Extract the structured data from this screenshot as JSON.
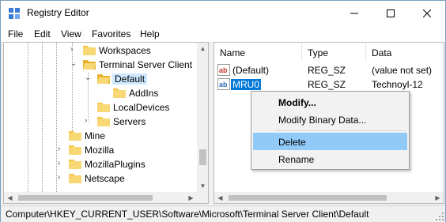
{
  "window": {
    "title": "Registry Editor",
    "icon": "registry-icon"
  },
  "menu": [
    "File",
    "Edit",
    "View",
    "Favorites",
    "Help"
  ],
  "tree": {
    "items": [
      {
        "label": "Workspaces",
        "expander": "collapsed"
      },
      {
        "label": "Terminal Server Client",
        "expander": "expanded"
      },
      {
        "label": "Default",
        "expander": "expanded",
        "selected": true
      },
      {
        "label": "AddIns",
        "expander": "none"
      },
      {
        "label": "LocalDevices",
        "expander": "none"
      },
      {
        "label": "Servers",
        "expander": "collapsed"
      },
      {
        "label": "Mine",
        "expander": "none"
      },
      {
        "label": "Mozilla",
        "expander": "collapsed"
      },
      {
        "label": "MozillaPlugins",
        "expander": "collapsed"
      },
      {
        "label": "Netscape",
        "expander": "collapsed"
      }
    ]
  },
  "list": {
    "columns": [
      "Name",
      "Type",
      "Data"
    ],
    "rows": [
      {
        "name": "(Default)",
        "type": "REG_SZ",
        "data": "(value not set)",
        "icon": "string-value-icon"
      },
      {
        "name": "MRU0",
        "type": "REG_SZ",
        "data": "Technoyl-12",
        "icon": "string-value-icon",
        "selected": true
      }
    ]
  },
  "context_menu": {
    "items": [
      {
        "label": "Modify...",
        "bold": true
      },
      {
        "label": "Modify Binary Data..."
      },
      {
        "label": "Delete",
        "highlighted": true
      },
      {
        "label": "Rename"
      }
    ]
  },
  "status": {
    "path": "Computer\\HKEY_CURRENT_USER\\Software\\Microsoft\\Terminal Server Client\\Default"
  },
  "colors": {
    "selection": "#0078d7",
    "menu_highlight": "#91c9f7",
    "folder": "#f5c542"
  }
}
